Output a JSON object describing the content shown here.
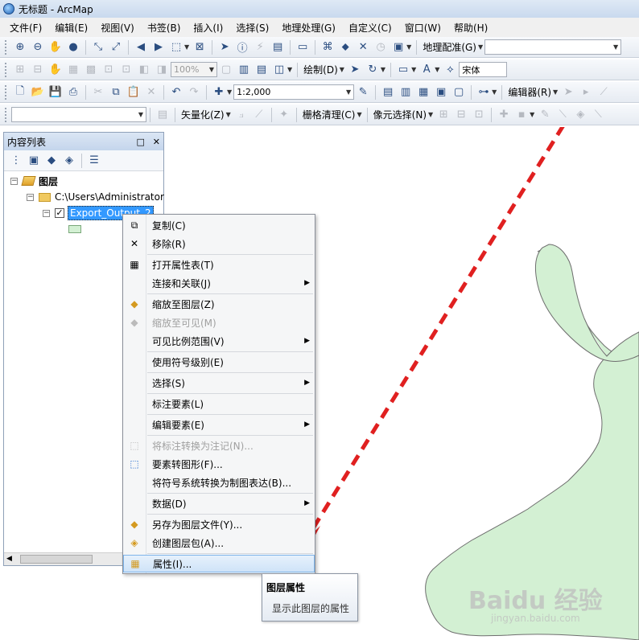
{
  "window": {
    "title": "无标题 - ArcMap"
  },
  "menubar": [
    "文件(F)",
    "编辑(E)",
    "视图(V)",
    "书签(B)",
    "插入(I)",
    "选择(S)",
    "地理处理(G)",
    "自定义(C)",
    "窗口(W)",
    "帮助(H)"
  ],
  "toolbar1": {
    "georef_label": "地理配准(G)",
    "georef_combo": ""
  },
  "toolbar2": {
    "zoom_percent": "100%",
    "draw_label": "绘制(D)",
    "font_combo": "宋体"
  },
  "toolbar3": {
    "scale": "1:2,000",
    "editor_label": "编辑器(R)"
  },
  "toolbar4": {
    "vectorize_label": "矢量化(Z)",
    "raster_cleanup_label": "栅格清理(C)",
    "cell_select_label": "像元选择(N)"
  },
  "toc": {
    "title": "内容列表",
    "root_label": "图层",
    "folder_label": "C:\\Users\\Administrator",
    "layer_label": "Export_Output_2"
  },
  "context_menu": {
    "items": [
      {
        "label": "复制(C)",
        "icon": "copy-icon",
        "enabled": true,
        "submenu": false
      },
      {
        "label": "移除(R)",
        "icon": "remove-x-icon",
        "enabled": true,
        "submenu": false
      },
      {
        "label": "打开属性表(T)",
        "icon": "table-icon",
        "enabled": true,
        "submenu": false
      },
      {
        "label": "连接和关联(J)",
        "icon": "",
        "enabled": true,
        "submenu": true
      },
      {
        "label": "缩放至图层(Z)",
        "icon": "zoom-to-layer-icon",
        "enabled": true,
        "submenu": false
      },
      {
        "label": "缩放至可见(M)",
        "icon": "zoom-visible-icon",
        "enabled": false,
        "submenu": false
      },
      {
        "label": "可见比例范围(V)",
        "icon": "",
        "enabled": true,
        "submenu": true
      },
      {
        "label": "使用符号级别(E)",
        "icon": "",
        "enabled": true,
        "submenu": false
      },
      {
        "label": "选择(S)",
        "icon": "",
        "enabled": true,
        "submenu": true
      },
      {
        "label": "标注要素(L)",
        "icon": "",
        "enabled": true,
        "submenu": false
      },
      {
        "label": "编辑要素(E)",
        "icon": "",
        "enabled": true,
        "submenu": true
      },
      {
        "label": "将标注转换为注记(N)...",
        "icon": "convert-labels-icon",
        "enabled": false,
        "submenu": false
      },
      {
        "label": "要素转图形(F)...",
        "icon": "features-to-graphics-icon",
        "enabled": true,
        "submenu": false
      },
      {
        "label": "将符号系统转换为制图表达(B)...",
        "icon": "",
        "enabled": true,
        "submenu": false
      },
      {
        "label": "数据(D)",
        "icon": "",
        "enabled": true,
        "submenu": true
      },
      {
        "label": "另存为图层文件(Y)...",
        "icon": "layer-file-icon",
        "enabled": true,
        "submenu": false
      },
      {
        "label": "创建图层包(A)...",
        "icon": "layer-package-icon",
        "enabled": true,
        "submenu": false
      },
      {
        "label": "属性(I)...",
        "icon": "properties-icon",
        "enabled": true,
        "submenu": false,
        "highlighted": true
      }
    ]
  },
  "tooltip": {
    "title": "图层属性",
    "description": "显示此图层的属性"
  },
  "watermark": {
    "main": "Baidu 经验",
    "sub": "jingyan.baidu.com"
  },
  "colors": {
    "polygon_fill": "#d3f0d3",
    "polygon_stroke": "#6e6e6e",
    "arrow": "#e02020",
    "selection": "#3399ff"
  }
}
